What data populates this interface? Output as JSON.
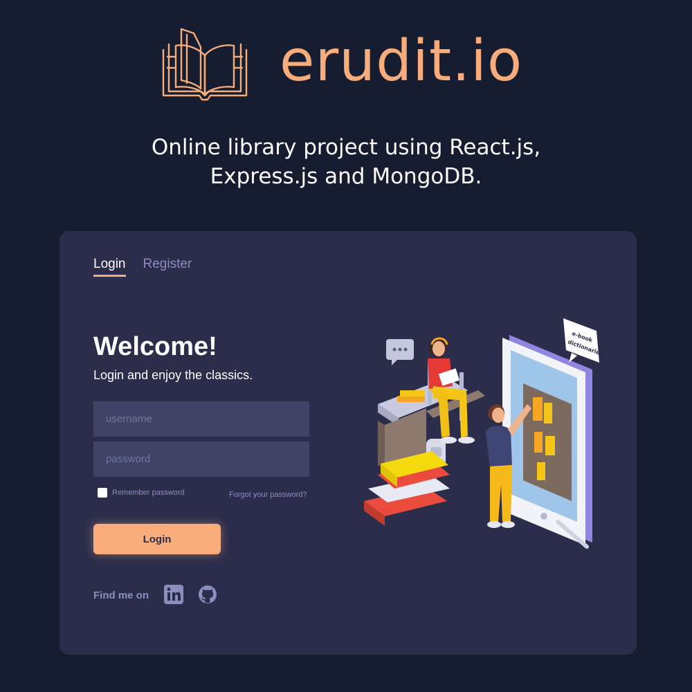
{
  "brand": {
    "name": "erudit.io",
    "accent_color": "#f6ad7b",
    "logo_icon": "open-book-icon"
  },
  "tagline": {
    "line1": "Online library project using React.js,",
    "line2": "Express.js and MongoDB."
  },
  "tabs": [
    {
      "label": "Login",
      "active": true
    },
    {
      "label": "Register",
      "active": false
    }
  ],
  "form": {
    "heading": "Welcome!",
    "subheading": "Login and enjoy the classics.",
    "username_placeholder": "username",
    "password_placeholder": "password",
    "remember_label": "Remember password",
    "forgot_label": "Forgot your password?",
    "submit_label": "Login"
  },
  "footer": {
    "find_me_label": "Find me on",
    "icons": [
      "linkedin-icon",
      "github-icon"
    ]
  },
  "illustration": {
    "bubble_text_1": "e-book",
    "bubble_text_2": "dictionaries"
  }
}
